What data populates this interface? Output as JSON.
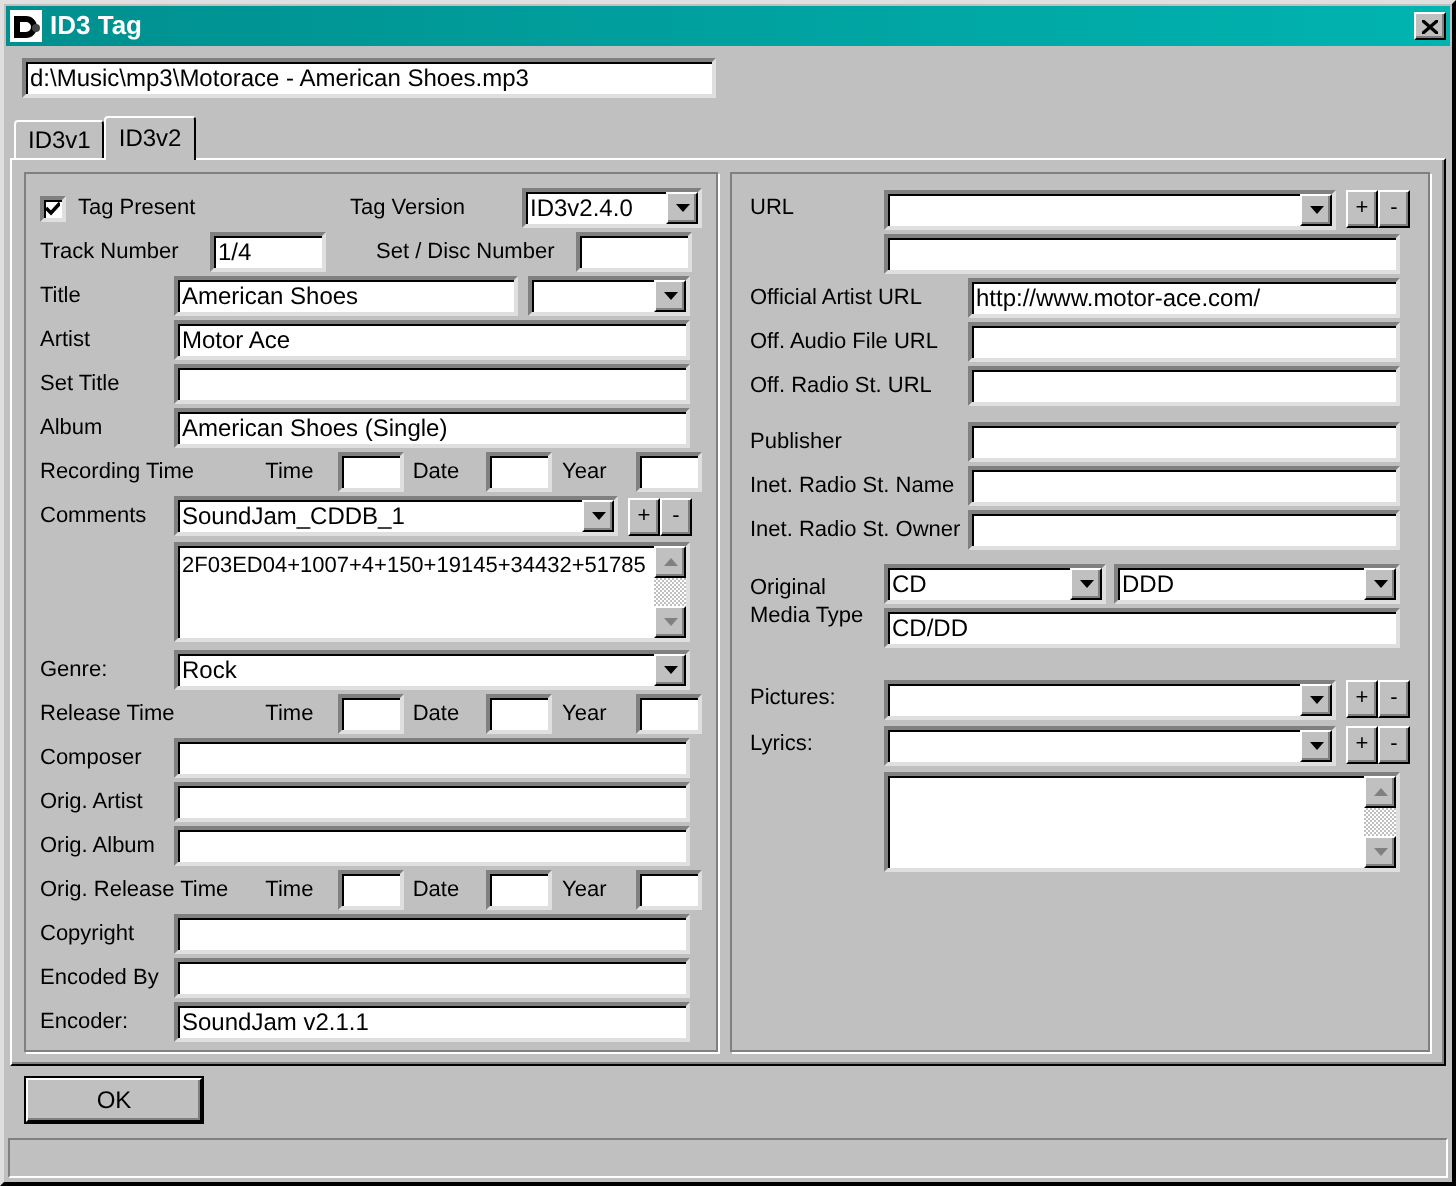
{
  "window": {
    "title": "ID3 Tag"
  },
  "file_path": "d:\\Music\\mp3\\Motorace - American Shoes.mp3",
  "tabs": [
    {
      "label": "ID3v1",
      "selected": false
    },
    {
      "label": "ID3v2",
      "selected": true
    }
  ],
  "left": [
    {
      "kind": "header",
      "label": "Tag Present",
      "checked": true,
      "version_label": "Tag Version",
      "version": "ID3v2.4.0"
    },
    {
      "kind": "track",
      "label": "Track Number",
      "value": "1/4",
      "disc_label": "Set / Disc Number"
    },
    {
      "kind": "title",
      "label": "Title",
      "value": "American Shoes"
    },
    {
      "kind": "text",
      "label": "Artist",
      "value": "Motor Ace"
    },
    {
      "kind": "text",
      "label": "Set Title"
    },
    {
      "kind": "text",
      "label": "Album",
      "value": "American Shoes (Single)"
    },
    {
      "kind": "times",
      "label": "Recording Time",
      "parts": [
        "Time",
        "Date",
        "Year"
      ]
    },
    {
      "kind": "list",
      "label": "Comments",
      "value": "SoundJam_CDDB_1",
      "buttons": [
        "+",
        "-"
      ]
    },
    {
      "kind": "memo",
      "value": "2F03ED04+1007+4+150+19145+34432+51785"
    },
    {
      "kind": "combo",
      "label": "Genre:",
      "value": "Rock"
    },
    {
      "kind": "times",
      "label": "Release Time",
      "parts": [
        "Time",
        "Date",
        "Year"
      ]
    },
    {
      "kind": "text",
      "label": "Composer"
    },
    {
      "kind": "text",
      "label": "Orig. Artist"
    },
    {
      "kind": "text",
      "label": "Orig. Album"
    },
    {
      "kind": "times",
      "label": "Orig. Release Time",
      "parts": [
        "Time",
        "Date",
        "Year"
      ]
    },
    {
      "kind": "text",
      "label": "Copyright"
    },
    {
      "kind": "text",
      "label": "Encoded By"
    },
    {
      "kind": "text",
      "label": "Encoder:",
      "value": "SoundJam v2.1.1"
    }
  ],
  "right": [
    [
      {
        "kind": "list",
        "label": "URL",
        "buttons": [
          "+",
          "-"
        ]
      },
      {
        "kind": "field"
      },
      {
        "kind": "wide",
        "label": "Official Artist URL",
        "value": "http://www.motor-ace.com/"
      },
      {
        "kind": "wide",
        "label": "Off. Audio File URL"
      },
      {
        "kind": "wide",
        "label": "Off. Radio St. URL"
      }
    ],
    [
      {
        "kind": "wide",
        "label": "Publisher"
      },
      {
        "kind": "wide",
        "label": "Inet. Radio St. Name"
      },
      {
        "kind": "wide",
        "label": "Inet. Radio St. Owner"
      }
    ],
    [
      {
        "kind": "media",
        "label": "Original Media Type",
        "media": "CD",
        "process": "DDD",
        "value": "CD/DD"
      }
    ],
    [
      {
        "kind": "list",
        "label": "Pictures:",
        "buttons": [
          "+",
          "-"
        ]
      },
      {
        "kind": "list",
        "label": "Lyrics:",
        "buttons": [
          "+",
          "-"
        ]
      },
      {
        "kind": "memo"
      }
    ]
  ],
  "ok_button": "OK"
}
